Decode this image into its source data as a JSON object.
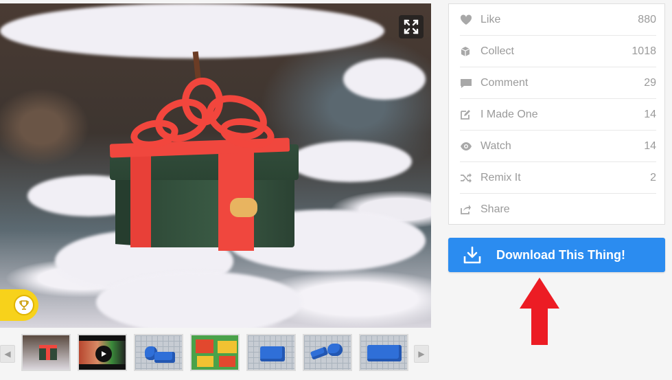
{
  "stats": [
    {
      "icon": "heart-icon",
      "label": "Like",
      "count": "880"
    },
    {
      "icon": "cube-icon",
      "label": "Collect",
      "count": "1018"
    },
    {
      "icon": "comment-icon",
      "label": "Comment",
      "count": "29"
    },
    {
      "icon": "edit-icon",
      "label": "I Made One",
      "count": "14"
    },
    {
      "icon": "eye-icon",
      "label": "Watch",
      "count": "14"
    },
    {
      "icon": "shuffle-icon",
      "label": "Remix It",
      "count": "2"
    },
    {
      "icon": "share-icon",
      "label": "Share",
      "count": ""
    }
  ],
  "download": {
    "label": "Download This Thing!",
    "icon": "download-icon"
  },
  "gallery": {
    "thumbnail_count": 7,
    "controls": [
      "fullscreen-icon",
      "trophy-icon",
      "chevron-left-icon",
      "chevron-right-icon",
      "play-icon"
    ]
  },
  "colors": {
    "accent_blue": "#2b8cf0",
    "stat_text": "#9a9a9a",
    "annotation_red": "#ec1c24",
    "badge_yellow": "#f7d21b"
  }
}
